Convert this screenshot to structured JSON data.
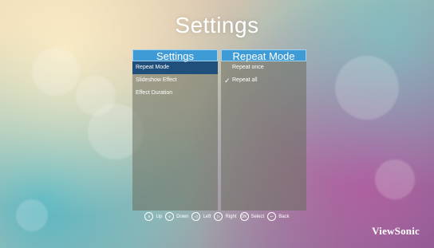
{
  "title": "Settings",
  "left_panel": {
    "header": "Settings",
    "items": [
      "Repeat Mode",
      "Slideshow Effect",
      "Effect Duration"
    ],
    "selected_index": 0
  },
  "right_panel": {
    "header": "Repeat Mode",
    "items": [
      "Repeat once",
      "Repeat all"
    ],
    "checked_index": 1
  },
  "hints": [
    {
      "icon": "up-icon",
      "glyph": "∧",
      "label": "Up"
    },
    {
      "icon": "down-icon",
      "glyph": "∨",
      "label": "Down"
    },
    {
      "icon": "left-icon",
      "glyph": "◁",
      "label": "Left"
    },
    {
      "icon": "right-icon",
      "glyph": "▷",
      "label": "Right"
    },
    {
      "icon": "ok-icon",
      "glyph": "OK",
      "label": "Select"
    },
    {
      "icon": "back-icon",
      "glyph": "↩",
      "label": "Back"
    }
  ],
  "brand": "ViewSonic",
  "colors": {
    "header": "#3f9bd6",
    "selected": "#1f4f7a"
  }
}
